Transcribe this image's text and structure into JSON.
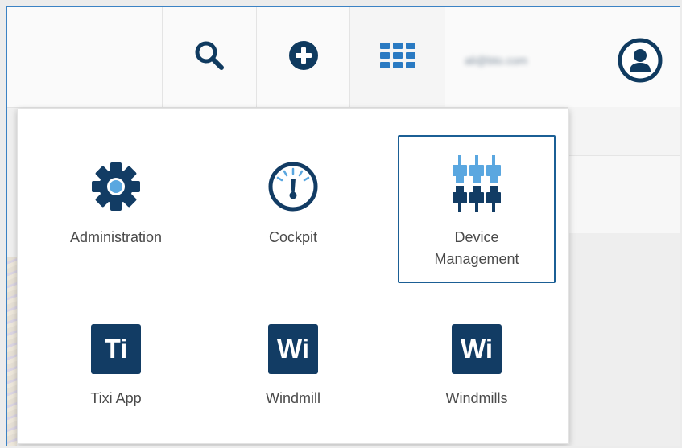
{
  "header": {
    "search_icon": "search-icon",
    "add_icon": "plus-circle-icon",
    "apps_icon": "app-grid-icon",
    "user_email": "ali@bto.com",
    "user_icon": "user-circle-icon"
  },
  "app_switcher": {
    "apps": [
      {
        "label": "Administration",
        "icon": "gear-icon",
        "active": false
      },
      {
        "label": "Cockpit",
        "icon": "gauge-icon",
        "active": false
      },
      {
        "label_line1": "Device",
        "label_line2": "Management",
        "icon": "device-connectors-icon",
        "active": true
      },
      {
        "label": "Tixi App",
        "icon_text": "Ti",
        "active": false
      },
      {
        "label": "Windmill",
        "icon_text": "Wi",
        "active": false
      },
      {
        "label": "Windmills",
        "icon_text": "Wi",
        "active": false
      }
    ]
  },
  "colors": {
    "brand_dark": "#123c64",
    "accent_blue": "#2a7ac2",
    "light_blue": "#5aa7e0",
    "frame_border": "#3b82c4"
  }
}
